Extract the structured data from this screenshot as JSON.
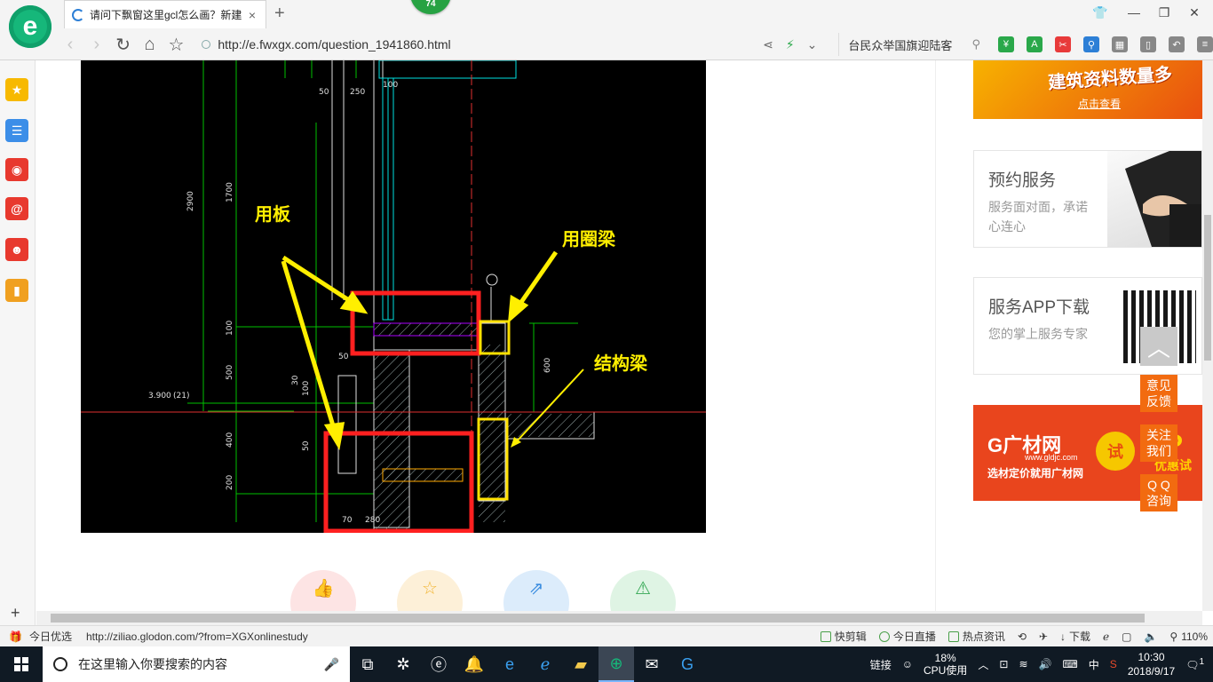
{
  "browser": {
    "badge_count": "74",
    "tab_title": "请问下飘窗这里gcl怎么画？新建",
    "tab_close": "×",
    "new_tab": "+",
    "url": "http://e.fwxgx.com/question_1941860.html",
    "search_text": "台民众举国旗迎陆客",
    "window_controls": [
      "minimize",
      "restore",
      "close"
    ]
  },
  "sidebar": {
    "items": [
      "favorites-star",
      "reading-list",
      "weibo",
      "mail",
      "game",
      "notes"
    ],
    "add_label": "+"
  },
  "cad_annotations": {
    "label_board": "用板",
    "label_ring_beam": "用圈梁",
    "label_struct_beam": "结构梁",
    "dims": [
      "50",
      "250",
      "100",
      "2900",
      "1700",
      "100",
      "50",
      "500",
      "30",
      "100",
      "400",
      "50",
      "600",
      "200",
      "70",
      "280",
      "3.900",
      "(21)"
    ]
  },
  "ads": {
    "top_title": "建筑资料数量多",
    "top_link": "点击查看",
    "svc1_title": "预约服务",
    "svc1_desc": "服务面对面，承诺心连心",
    "svc2_title": "服务APP下载",
    "svc2_desc": "您的掌上服务专家",
    "gcw_logo": "G广材网",
    "gcw_url": "www.gldjc.com",
    "gcw_slogan": "选材定价就用广材网",
    "gcw_try": "试",
    "gcw_p": "P",
    "gcw_free": "优惠试用"
  },
  "float_buttons": {
    "feedback": "意见\n反馈",
    "follow": "关注\n我们",
    "qq": "Q Q\n咨询",
    "top_arrow": "︿"
  },
  "statusbar": {
    "left_label": "今日优选",
    "left_url": "http://ziliao.glodon.com/?from=XGXonlinestudy",
    "items": [
      "快剪辑",
      "今日直播",
      "热点资讯"
    ],
    "download": "下载",
    "zoom": "110%"
  },
  "taskbar": {
    "search_placeholder": "在这里输入你要搜索的内容",
    "tray_link": "链接",
    "cpu_percent": "18%",
    "cpu_label": "CPU使用",
    "ime": "中",
    "time": "10:30",
    "date": "2018/9/17",
    "notification_count": "1"
  }
}
